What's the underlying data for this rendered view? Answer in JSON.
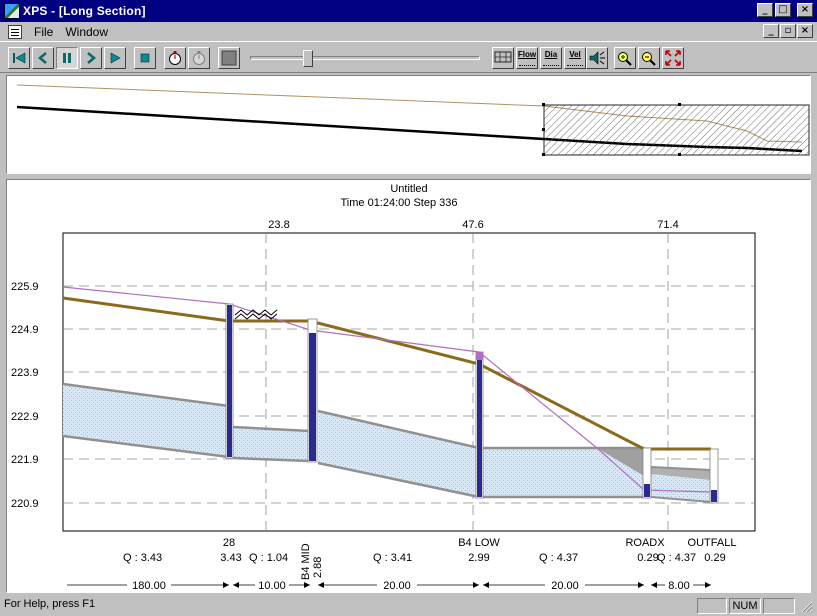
{
  "window": {
    "title": "XPS - [Long Section]"
  },
  "menu": {
    "items": [
      "File",
      "Window"
    ]
  },
  "toolbar": {
    "mode_buttons": [
      {
        "label": "Flow"
      },
      {
        "label": "Dia"
      },
      {
        "label": "Vel"
      }
    ],
    "slider_fraction": 0.24
  },
  "colors": {
    "ground": "#8b6a1c",
    "hgl": "#b070c0",
    "pipe": "#909090",
    "water": "#cfe2f5",
    "manhole": "#2a2a90",
    "grid": "#8a8a8a"
  },
  "section": {
    "title": "Untitled",
    "subtitle": "Time 01:24:00 Step 336",
    "top_ticks": [
      "23.8",
      "47.6",
      "71.4"
    ],
    "y_ticks": [
      "225.9",
      "224.9",
      "223.9",
      "222.9",
      "221.9",
      "220.9"
    ],
    "nodes": [
      {
        "name": "28"
      },
      {
        "name": "B4 MID"
      },
      {
        "name": "B4 LOW"
      },
      {
        "name": "ROADX"
      },
      {
        "name": "OUTFALL"
      }
    ],
    "node_values": [
      "3.43",
      "2.88",
      "2.99",
      "0.29",
      "0.29"
    ],
    "flows": [
      {
        "text": "Q :  3.43"
      },
      {
        "text": "Q :  1.04"
      },
      {
        "text": "Q :  3.41"
      },
      {
        "text": "Q :  4.37"
      },
      {
        "text": "Q :  4.37"
      }
    ],
    "lengths": [
      "180.00",
      "10.00",
      "20.00",
      "20.00",
      "8.00"
    ]
  },
  "status": {
    "text": "For Help, press F1",
    "panes": [
      "",
      "NUM",
      ""
    ]
  }
}
